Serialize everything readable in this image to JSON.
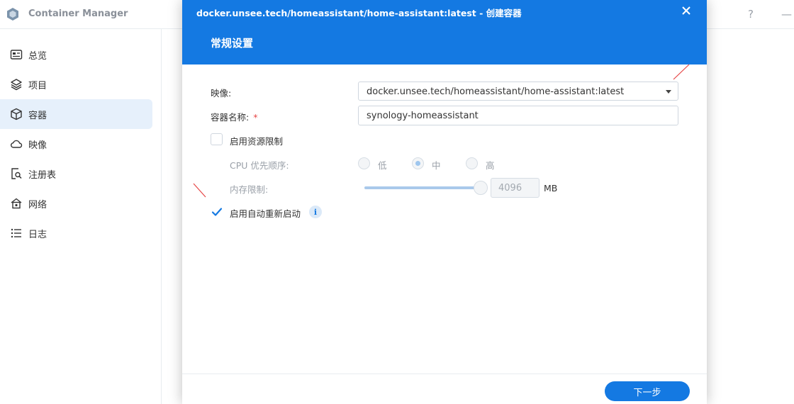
{
  "app": {
    "title": "Container Manager",
    "help_glyph": "?",
    "minimize_glyph": "—"
  },
  "sidebar": {
    "items": [
      {
        "label": "总览",
        "icon": "overview-icon",
        "active": false
      },
      {
        "label": "项目",
        "icon": "project-layers-icon",
        "active": false
      },
      {
        "label": "容器",
        "icon": "container-cube-icon",
        "active": true
      },
      {
        "label": "映像",
        "icon": "cloud-icon",
        "active": false
      },
      {
        "label": "注册表",
        "icon": "registry-search-icon",
        "active": false
      },
      {
        "label": "网络",
        "icon": "network-house-icon",
        "active": false
      },
      {
        "label": "日志",
        "icon": "log-list-icon",
        "active": false
      }
    ]
  },
  "dialog": {
    "title": "docker.unsee.tech/homeassistant/home-assistant:latest - 创建容器",
    "subtitle": "常规设置",
    "close_icon": "close-icon",
    "image_label": "映像:",
    "image_value": "docker.unsee.tech/homeassistant/home-assistant:latest",
    "container_name_label": "容器名称:",
    "required_mark": "*",
    "container_name_value": "synology-homeassistant",
    "resource_limit_label": "启用资源限制",
    "resource_limit_checked": false,
    "cpu_priority_label": "CPU 优先顺序:",
    "cpu_options": [
      "低",
      "中",
      "高"
    ],
    "cpu_selected": "中",
    "memory_label": "内存限制:",
    "memory_value": "4096",
    "memory_unit": "MB",
    "memory_slider_level": 1.0,
    "auto_restart_label": "启用自动重新启动",
    "auto_restart_checked": true,
    "info_glyph": "i",
    "next_button": "下一步"
  },
  "colors": {
    "accent": "#1479e2",
    "active_nav_bg": "#e6f0fb",
    "annotation_red": "#e64646"
  }
}
